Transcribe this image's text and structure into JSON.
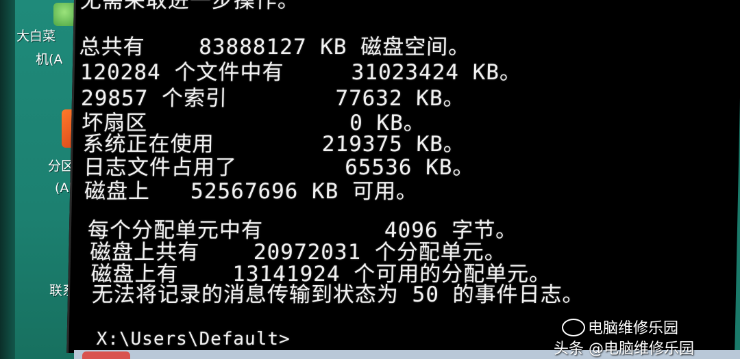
{
  "desktop": {
    "icons": [
      {
        "label_line1": "大白菜",
        "label_line2": "机(A"
      },
      {
        "label_line1": "分区",
        "label_line2": "(Al"
      },
      {
        "label_line1": "联系",
        "label_line2": ""
      }
    ]
  },
  "console": {
    "lines": [
      "无需采取进一步操作。",
      "总共有    83888127 KB 磁盘空间。",
      "120284 个文件中有     31023424 KB。",
      "29857 个索引        77632 KB。",
      "坏扇区               0 KB。",
      "系统正在使用        219375 KB。",
      "日志文件占用了        65536 KB。",
      "磁盘上   52567696 KB 可用。",
      "",
      "每个分配单元中有         4096 字节。",
      "磁盘上共有    20972031 个分配单元。",
      "磁盘上有    13141924 个可用的分配单元。",
      "无法将记录的消息传输到状态为 50 的事件日志。",
      "",
      "X:\\Users\\Default>"
    ]
  },
  "watermark": {
    "top_text": "电脑维修乐园",
    "bottom_text": "头条 @电脑维修乐园"
  },
  "colors": {
    "console_bg": "#000000",
    "console_fg": "#f2f2f2",
    "desktop_bg": "#1c8070"
  }
}
